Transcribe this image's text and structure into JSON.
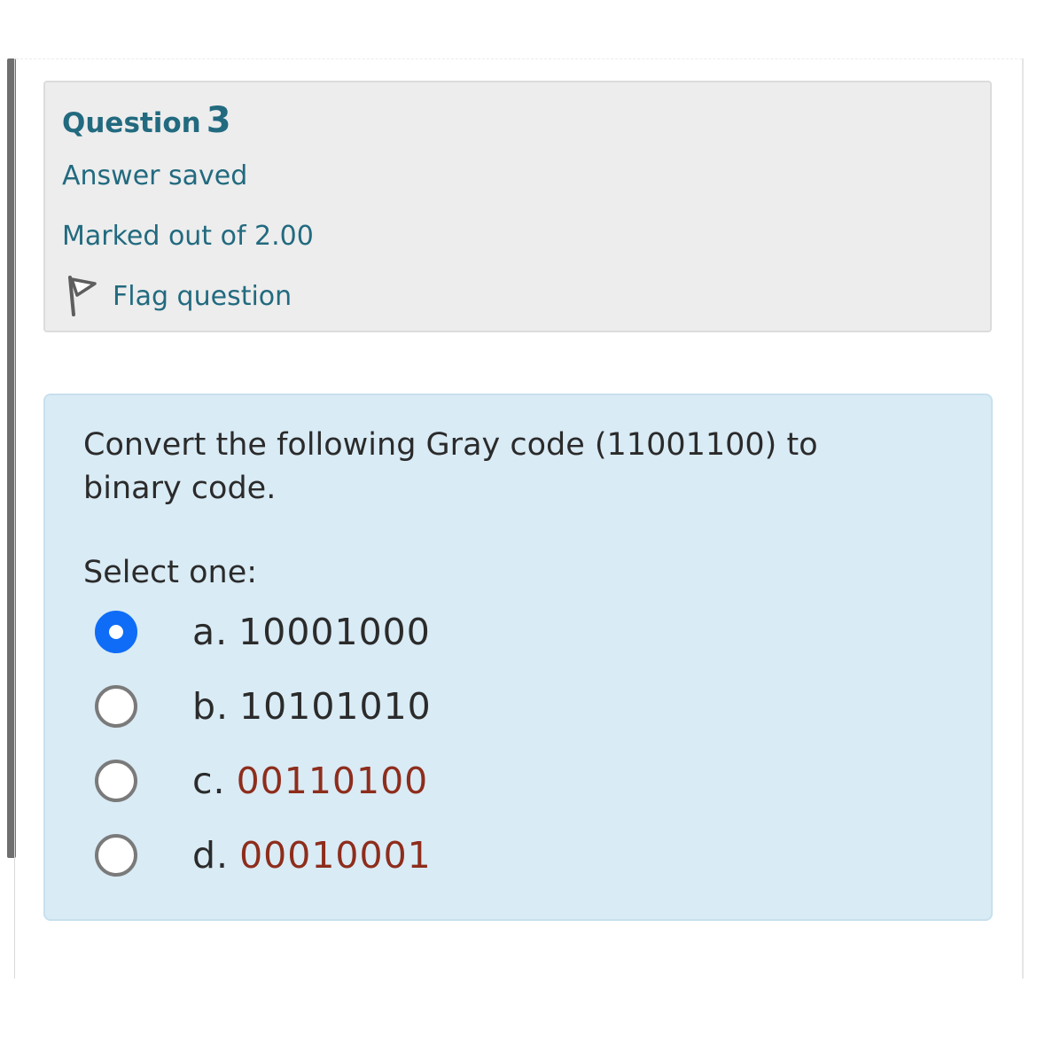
{
  "question": {
    "label": "Question",
    "number": "3",
    "state": "Answer saved",
    "grade": "Marked out of 2.00",
    "flag_label": "Flag question",
    "flag_icon": "flag-icon"
  },
  "content": {
    "question_text": "Convert the following Gray code (11001100) to binary code.",
    "prompt": "Select one:",
    "options": [
      {
        "letter": "a.",
        "value": "10001000",
        "selected": true,
        "value_color": "#2b2b2b"
      },
      {
        "letter": "b.",
        "value": "10101010",
        "selected": false,
        "value_color": "#2b2b2b"
      },
      {
        "letter": "c.",
        "value": "00110100",
        "selected": false,
        "value_color": "#8e2d1c"
      },
      {
        "letter": "d.",
        "value": "00010001",
        "selected": false,
        "value_color": "#8e2d1c"
      }
    ]
  },
  "colors": {
    "title_teal": "#226a7f",
    "radio_selected": "#0f6cf7",
    "content_bg": "#d9ebf5",
    "info_bg": "#ededed"
  }
}
